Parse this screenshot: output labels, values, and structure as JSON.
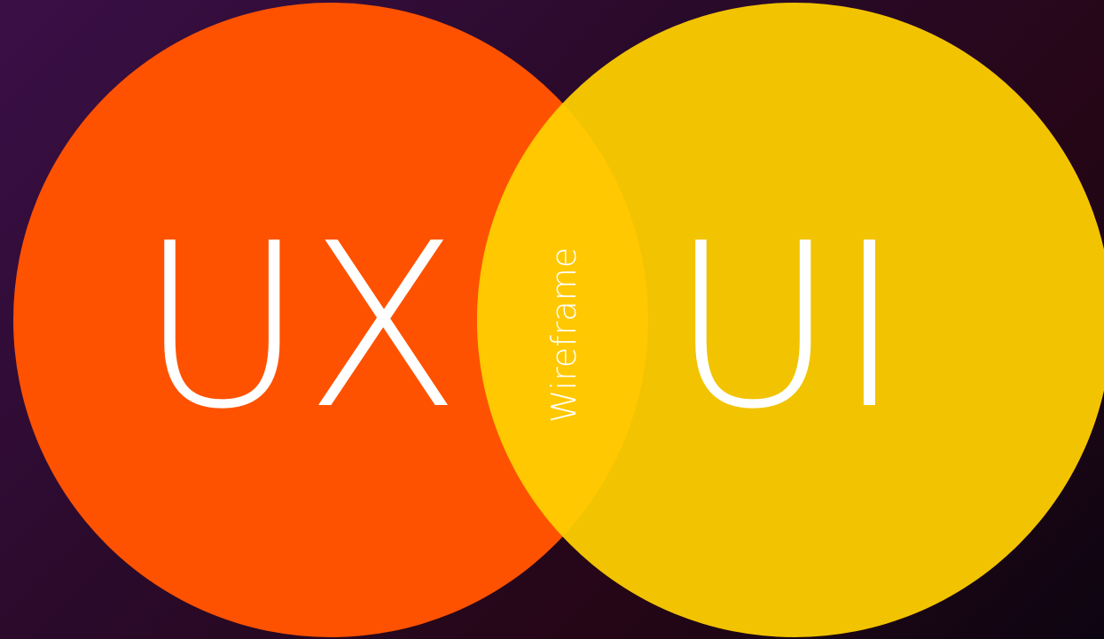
{
  "diagram": {
    "type": "venn",
    "left_set": {
      "label": "UX",
      "color": "#ff5200"
    },
    "right_set": {
      "label": "UI",
      "color": "#f2c300"
    },
    "overlap": {
      "label": "Wireframe",
      "color": "#ffc800"
    },
    "text_color": "#ffffff"
  }
}
